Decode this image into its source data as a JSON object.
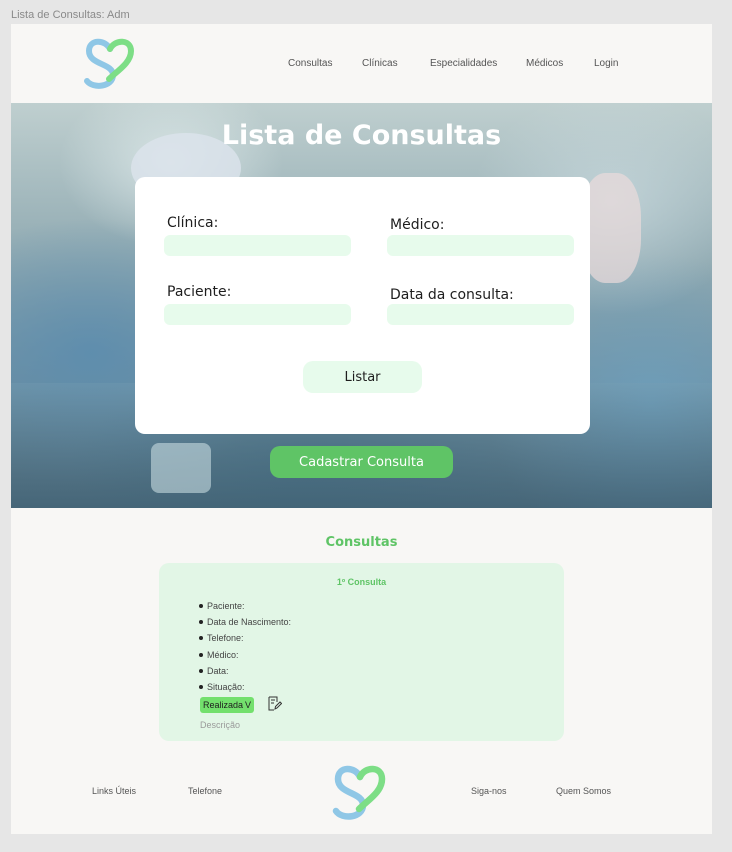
{
  "frame": {
    "label": "Lista de Consultas: Adm"
  },
  "header": {
    "logo_icon": "heart-s-logo-icon",
    "nav": [
      "Consultas",
      "Clínicas",
      "Especialidades",
      "Médicos",
      "Login"
    ]
  },
  "hero": {
    "title": "Lista de Consultas",
    "form": {
      "clinica_label": "Clínica:",
      "medico_label": "Médico:",
      "paciente_label": "Paciente:",
      "data_label": "Data da consulta:",
      "list_button": "Listar"
    },
    "cta_button": "Cadastrar Consulta"
  },
  "results": {
    "title": "Consultas",
    "card": {
      "heading": "1º Consulta",
      "fields": [
        "Paciente:",
        "Data de Nascimento:",
        "Telefone:",
        "Médico:",
        "Data:",
        "Situação:"
      ],
      "status": "Realizada",
      "status_caret": "V",
      "description": "Descrição",
      "edit_icon": "edit-note-icon"
    }
  },
  "footer": {
    "links_left": [
      "Links Úteis",
      "Telefone"
    ],
    "links_right": [
      "Siga-nos",
      "Quem Somos"
    ],
    "logo_icon": "heart-s-logo-icon"
  },
  "colors": {
    "accent_green": "#5fc466",
    "input_bg": "#e7fbec",
    "card_bg": "#e2f6e6",
    "status_bg": "#73e06d",
    "logo_blue": "#8fc7e6",
    "logo_green": "#7dde86"
  }
}
